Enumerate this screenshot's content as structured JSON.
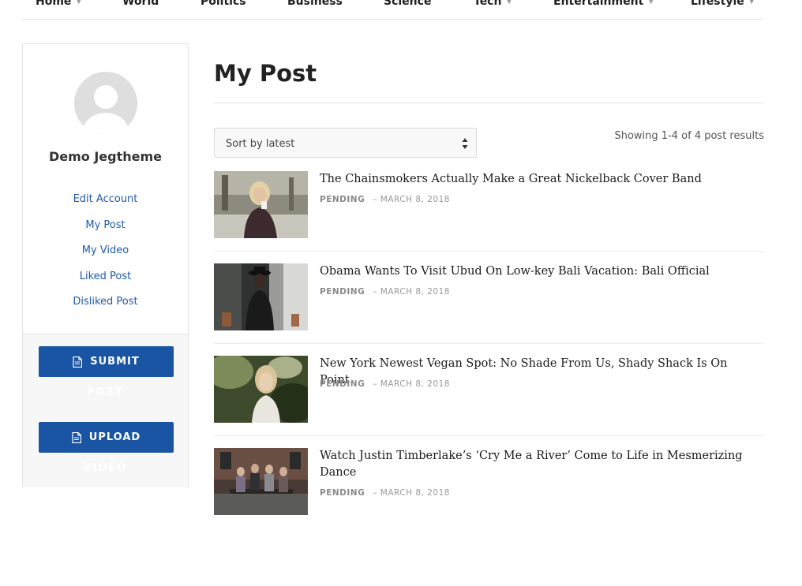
{
  "nav": {
    "items": [
      {
        "label": "Home",
        "has_caret": true
      },
      {
        "label": "World",
        "has_caret": false
      },
      {
        "label": "Politics",
        "has_caret": false
      },
      {
        "label": "Business",
        "has_caret": false
      },
      {
        "label": "Science",
        "has_caret": false
      },
      {
        "label": "Tech",
        "has_caret": true
      },
      {
        "label": "Entertainment",
        "has_caret": true
      },
      {
        "label": "Lifestyle",
        "has_caret": true
      }
    ]
  },
  "sidebar": {
    "username": "Demo Jegtheme",
    "links": [
      {
        "label": "Edit Account"
      },
      {
        "label": "My Post"
      },
      {
        "label": "My Video"
      },
      {
        "label": "Liked Post"
      },
      {
        "label": "Disliked Post"
      }
    ],
    "submit_label": "SUBMIT",
    "submit_overflow": "POST",
    "upload_label": "UPLOAD",
    "upload_overflow": "VIDEO"
  },
  "main": {
    "title": "My Post",
    "sort": {
      "selected": "Sort by latest"
    },
    "result_count": "Showing 1-4 of 4 post results",
    "posts": [
      {
        "title": "The Chainsmokers Actually Make a Great Nickelback Cover Band",
        "status": "PENDING",
        "date": "– MARCH 8, 2018"
      },
      {
        "title": "Obama Wants To Visit Ubud On Low-key Bali Vacation: Bali Official",
        "status": "PENDING",
        "date": "– MARCH 8, 2018"
      },
      {
        "title": "New York Newest Vegan Spot: No Shade From Us, Shady Shack Is On Point",
        "status": "PENDING",
        "date": "– MARCH 8, 2018"
      },
      {
        "title": "Watch Justin Timberlake’s ‘Cry Me a River’ Come to Life in Mesmerizing Dance",
        "status": "PENDING",
        "date": "– MARCH 8, 2018"
      }
    ]
  },
  "colors": {
    "accent": "#1a55a3",
    "link": "#1f5ba8",
    "meta": "#999999"
  },
  "icons": {
    "action_button": "document-icon",
    "sort": "sort-arrows-icon",
    "nav_dropdown": "caret-down-icon"
  }
}
